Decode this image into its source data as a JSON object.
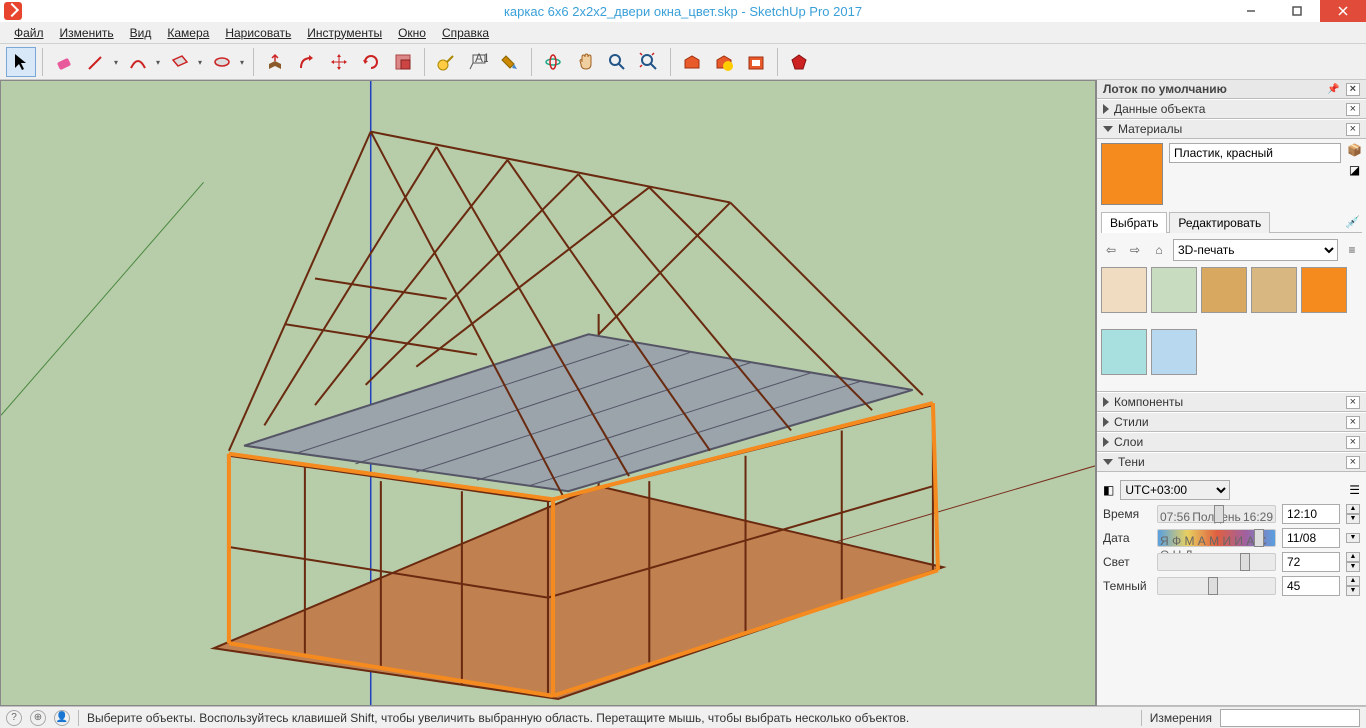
{
  "titlebar": {
    "title": "каркас 6х6 2х2х2_двери окна_цвет.skp - SketchUp Pro 2017"
  },
  "menu": {
    "file": "Файл",
    "edit": "Изменить",
    "view": "Вид",
    "camera": "Камера",
    "draw": "Нарисовать",
    "tools": "Инструменты",
    "window": "Окно",
    "help": "Справка"
  },
  "tools": {
    "select": "select",
    "eraser": "eraser",
    "line": "line",
    "arc": "arc",
    "rect": "rect",
    "circle": "circle",
    "pushpull": "pushpull",
    "offset": "offset",
    "move": "move",
    "rotate": "rotate",
    "scale": "scale",
    "tape": "tape",
    "text": "text",
    "paint": "paint",
    "orbit": "orbit",
    "pan": "pan",
    "zoom": "zoom",
    "zoom_ext": "zoom_ext",
    "warehouse": "warehouse",
    "wh_upload": "wh_upload",
    "ext": "ext",
    "ruby": "ruby"
  },
  "tray": {
    "title": "Лоток по умолчанию",
    "entity_info": "Данные объекта",
    "materials": {
      "title": "Материалы",
      "current_name": "Пластик, красный",
      "tab_select": "Выбрать",
      "tab_edit": "Редактировать",
      "library": "3D-печать",
      "swatches": [
        "#f0dcc0",
        "#c8dcc0",
        "#d8a860",
        "#d8b880",
        "#f58a1f",
        "#a8e0e0",
        "#b8d8f0"
      ]
    },
    "components": "Компоненты",
    "styles": "Стили",
    "layers": "Слои",
    "shadows": {
      "title": "Тени",
      "tz": "UTC+03:00",
      "time_label": "Время",
      "time_start": "07:56",
      "time_mid": "Полдень",
      "time_end": "16:29",
      "time_value": "12:10",
      "date_label": "Дата",
      "date_months": "Я Ф М А М И И А С О Н Д",
      "date_value": "11/08",
      "light_label": "Свет",
      "light_value": "72",
      "dark_label": "Темный",
      "dark_value": "45"
    }
  },
  "status": {
    "hint": "Выберите объекты. Воспользуйтесь клавишей Shift, чтобы увеличить выбранную область. Перетащите мышь, чтобы выбрать несколько объектов.",
    "measure_label": "Измерения"
  }
}
